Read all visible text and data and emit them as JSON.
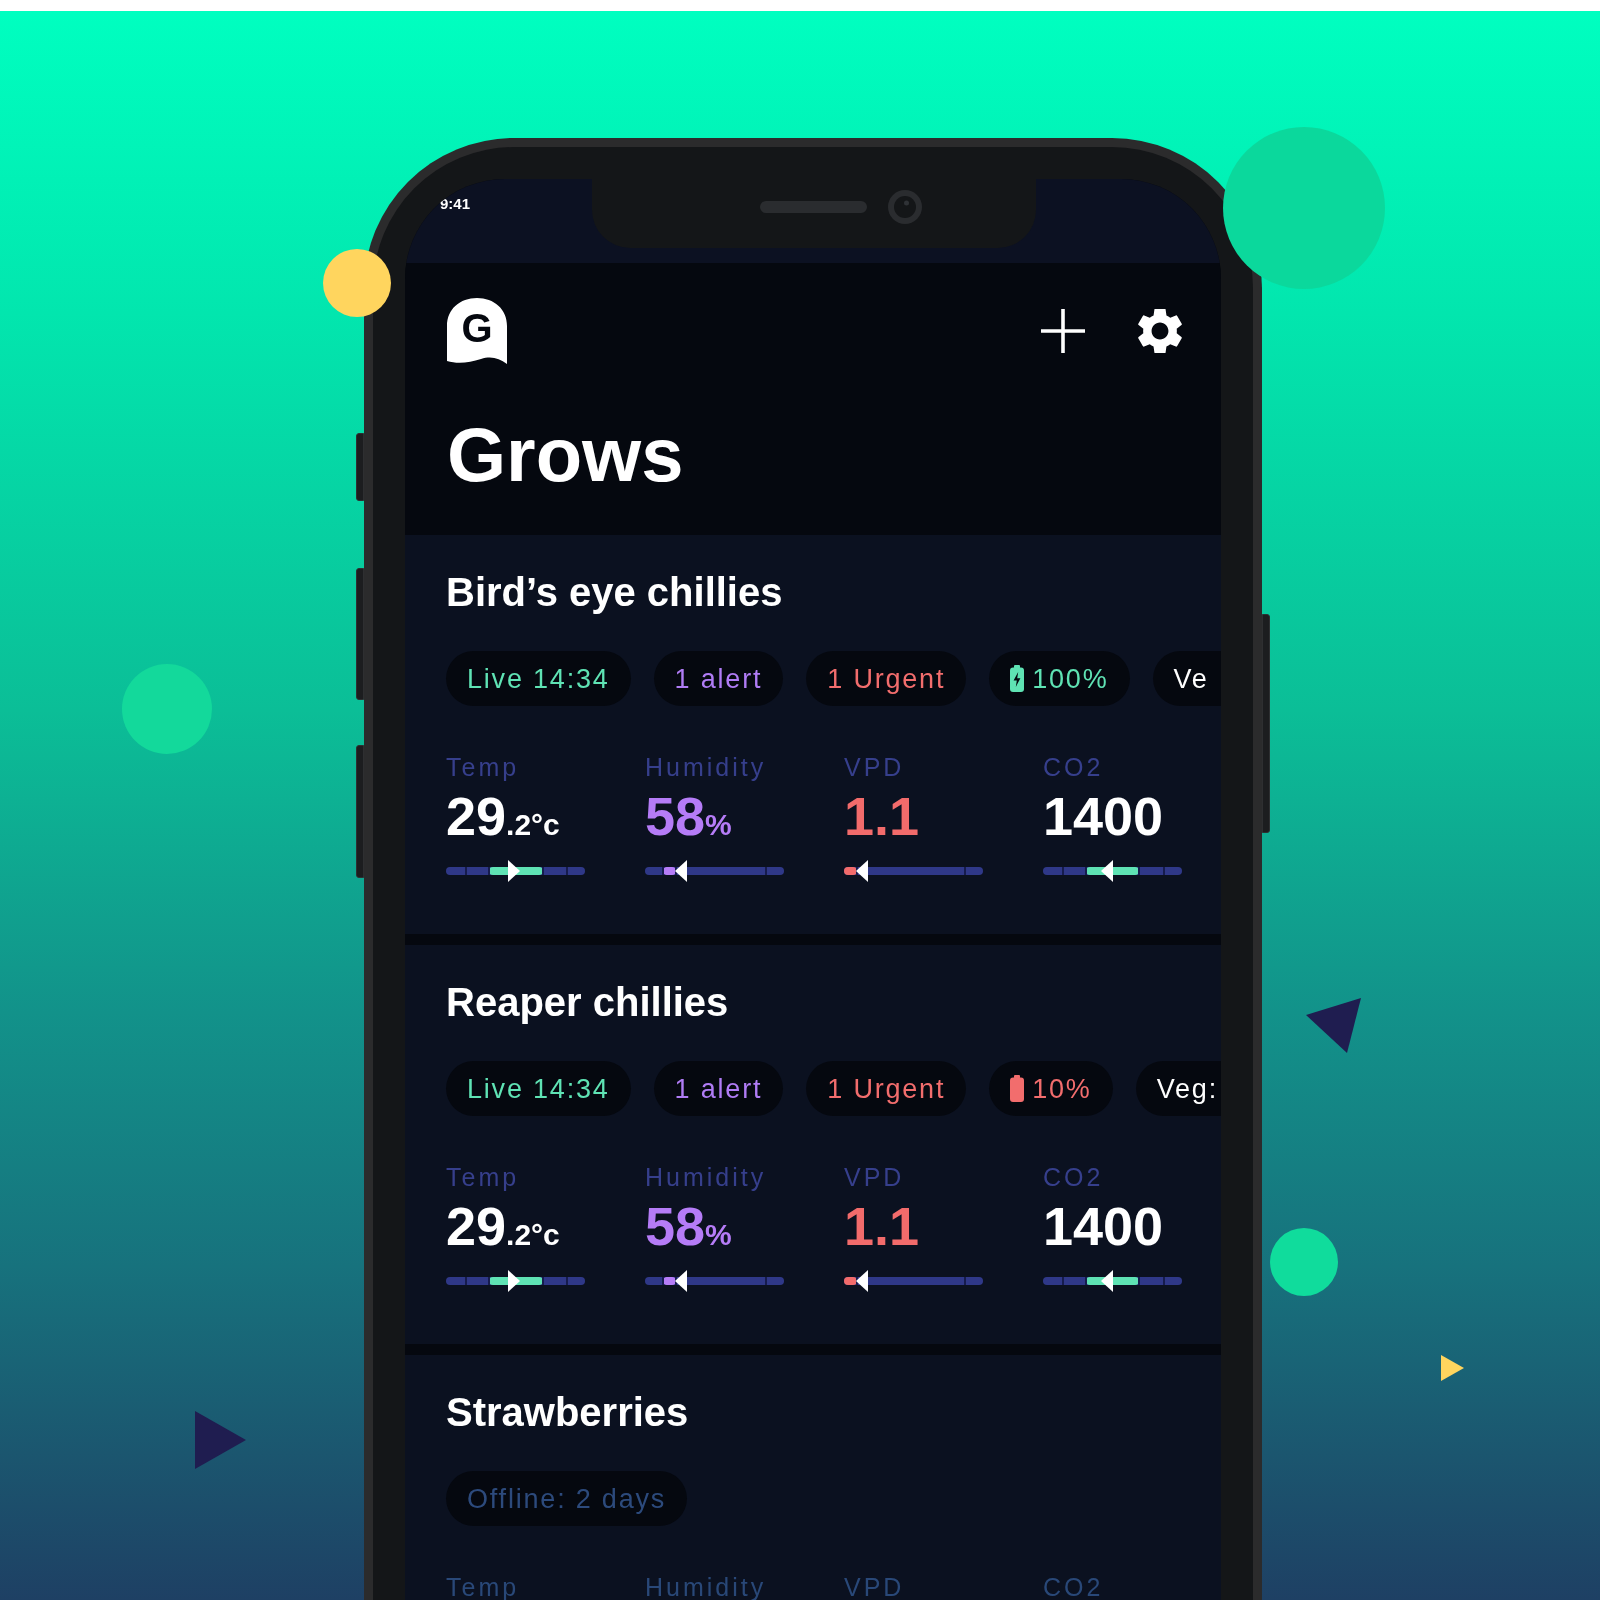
{
  "status_bar": {
    "time": "9:41"
  },
  "header": {
    "logo_letter": "G",
    "title": "Grows"
  },
  "grows": [
    {
      "name": "Bird’s eye chillies",
      "online": true,
      "chips": [
        {
          "kind": "live",
          "text": "Live 14:34",
          "color": "#5fe3b4"
        },
        {
          "kind": "alert",
          "text": "1 alert",
          "color": "#b07cf5"
        },
        {
          "kind": "urgent",
          "text": "1 Urgent",
          "color": "#f26d6d"
        },
        {
          "kind": "battery",
          "text": "100%",
          "color": "#5fe3b4",
          "charging": true
        },
        {
          "kind": "stage",
          "text": "Ve",
          "color": "#ffffff"
        }
      ],
      "metrics": [
        {
          "label": "Temp",
          "value": "29",
          "unit": ".2°c",
          "color": "#5fe3b4",
          "in_range": true,
          "rising": true,
          "band_start": {
            "level": 0.31
          },
          "band_end": {
            "level": 0.7
          },
          "level": 0.49
        },
        {
          "label": "Humidity",
          "value": "58",
          "unit": "%",
          "color": "#b57cf7",
          "in_range": false,
          "rising": false,
          "band_start": {
            "level": 0.13
          },
          "band_end": {
            "level": 0.22
          },
          "level": 0.26
        },
        {
          "label": "VPD",
          "value": "1.1",
          "color": "#f26b6b",
          "in_range": false,
          "rising": false,
          "band_end": {
            "level": 0.09
          },
          "level": 0.13
        },
        {
          "label": "CO2",
          "value": "1400",
          "color": "#5fe3b4",
          "in_range": true,
          "rising": false,
          "band_start": {
            "level": 0.31
          },
          "band_end": {
            "level": 0.69
          },
          "level": 0.46
        }
      ]
    },
    {
      "name": "Reaper chillies",
      "online": true,
      "chips": [
        {
          "kind": "live",
          "text": "Live 14:34",
          "color": "#5fe3b4"
        },
        {
          "kind": "alert",
          "text": "1 alert",
          "color": "#b07cf5"
        },
        {
          "kind": "urgent",
          "text": "1 Urgent",
          "color": "#f26d6d"
        },
        {
          "kind": "battery",
          "text": "10%",
          "color": "#f26d6d",
          "charging": false
        },
        {
          "kind": "stage",
          "text": "Veg:",
          "color": "#ffffff"
        }
      ],
      "metrics": [
        {
          "label": "Temp",
          "value": "29",
          "unit": ".2°c",
          "color": "#5fe3b4",
          "in_range": true,
          "rising": true,
          "band_start": {
            "level": 0.31
          },
          "band_end": {
            "level": 0.7
          },
          "level": 0.49
        },
        {
          "label": "Humidity",
          "value": "58",
          "unit": "%",
          "color": "#b57cf7",
          "in_range": false,
          "rising": false,
          "band_start": {
            "level": 0.13
          },
          "band_end": {
            "level": 0.22
          },
          "level": 0.26
        },
        {
          "label": "VPD",
          "value": "1.1",
          "color": "#f26b6b",
          "in_range": false,
          "rising": false,
          "band_end": {
            "level": 0.09
          },
          "level": 0.13
        },
        {
          "label": "CO2",
          "value": "1400",
          "color": "#5fe3b4",
          "in_range": true,
          "rising": false,
          "band_start": {
            "level": 0.31
          },
          "band_end": {
            "level": 0.69
          },
          "level": 0.46
        }
      ]
    },
    {
      "name": "Strawberries",
      "online": false,
      "chips": [
        {
          "kind": "offline",
          "text": "Offline: 2 days",
          "color": "#2c4a7c"
        }
      ],
      "metrics": [
        {
          "label": "Temp"
        },
        {
          "label": "Humidity"
        },
        {
          "label": "VPD"
        },
        {
          "label": "CO2"
        }
      ]
    }
  ]
}
